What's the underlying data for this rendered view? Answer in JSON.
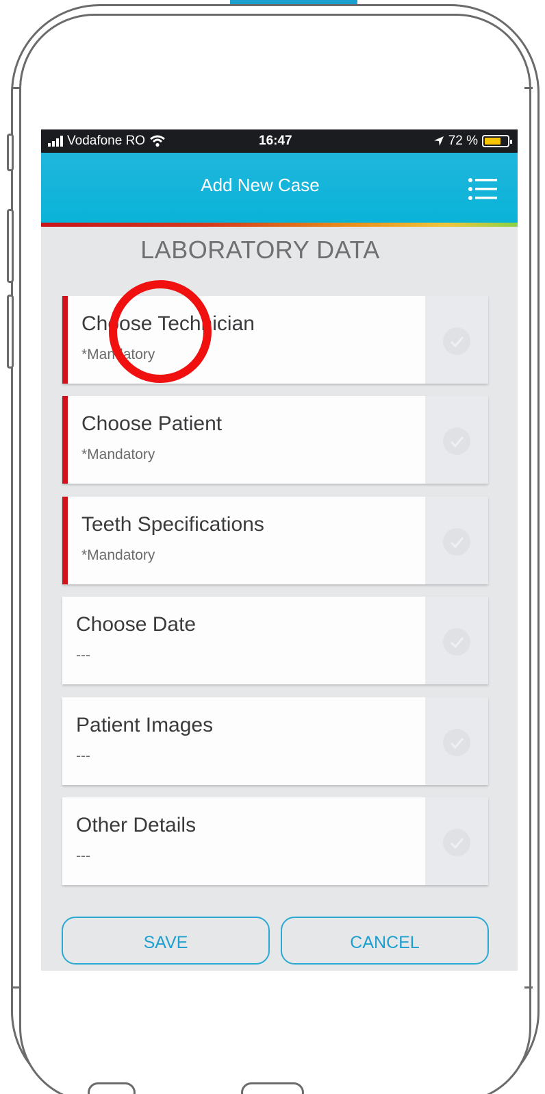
{
  "status_bar": {
    "carrier": "Vodafone RO",
    "time": "16:47",
    "battery_percent": "72 %",
    "battery_level": 0.72
  },
  "header": {
    "title": "Add New Case",
    "menu_icon": "list-menu-icon"
  },
  "section_title": "LABORATORY DATA",
  "cards": [
    {
      "title": "Choose Technician",
      "subtitle": "*Mandatory",
      "mandatory": true
    },
    {
      "title": "Choose Patient",
      "subtitle": "*Mandatory",
      "mandatory": true
    },
    {
      "title": "Teeth Specifications",
      "subtitle": "*Mandatory",
      "mandatory": true
    },
    {
      "title": "Choose Date",
      "subtitle": "---",
      "mandatory": false
    },
    {
      "title": "Patient Images",
      "subtitle": "---",
      "mandatory": false
    },
    {
      "title": "Other Details",
      "subtitle": "---",
      "mandatory": false
    }
  ],
  "buttons": {
    "save": "SAVE",
    "cancel": "CANCEL"
  },
  "colors": {
    "header_cyan": "#0ab3d8",
    "mandatory_red": "#d0121a",
    "button_blue": "#1e9fcf",
    "annotation_red": "#f01010"
  }
}
